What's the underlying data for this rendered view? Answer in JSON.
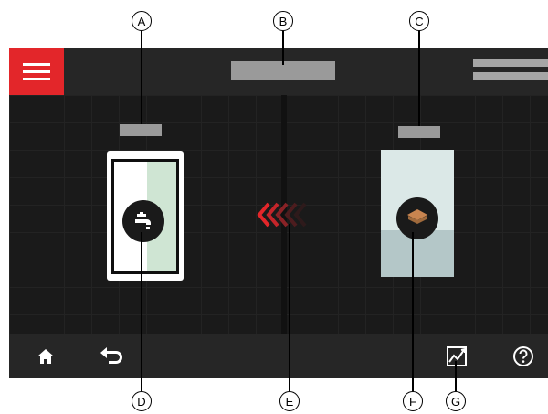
{
  "callouts": [
    "A",
    "B",
    "C",
    "D",
    "E",
    "F",
    "G"
  ],
  "colors": {
    "accent": "#e3262a",
    "screen_bg": "#1c1c1c",
    "bar_bg": "#262626",
    "placeholder": "#9a9a9a",
    "green_tint": "#cfe5d3",
    "storage_top": "#dbe8e7",
    "storage_bottom": "#b4c7c8"
  },
  "topbar": {
    "menu_icon": "hamburger-menu-icon",
    "title_icon": "title-placeholder",
    "right_icon": "status-lines"
  },
  "panels": {
    "left": {
      "icon": "water-tap-icon"
    },
    "right": {
      "icon": "layers-icon"
    },
    "flow_icon": "flow-direction-arrows-icon"
  },
  "bottombar": {
    "icons": [
      "home-icon",
      "back-arrow-icon",
      "chart-icon",
      "help-icon"
    ]
  }
}
